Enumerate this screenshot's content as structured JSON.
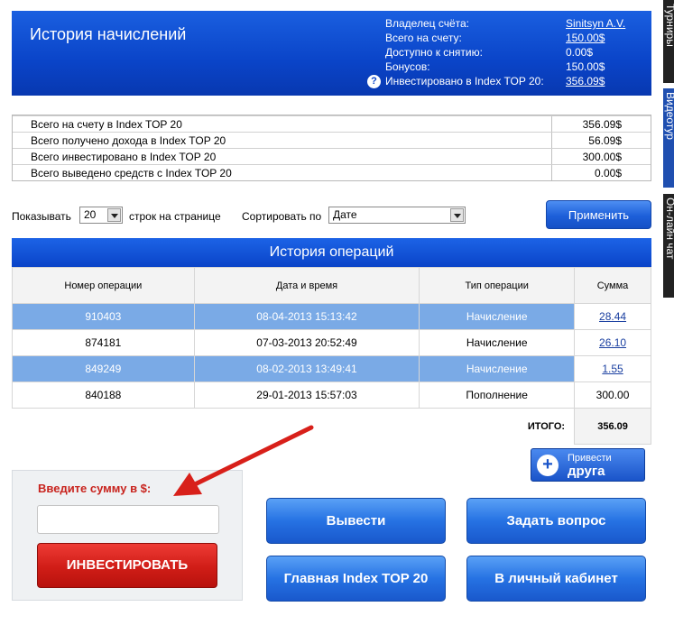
{
  "header": {
    "title": "История начислений",
    "account": [
      {
        "label": "Владелец счёта:",
        "value": "Sinitsyn A.V.",
        "link": true
      },
      {
        "label": "Всего на счету:",
        "value": "150.00$",
        "link": true
      },
      {
        "label": "Доступно к снятию:",
        "value": "0.00$",
        "link": false
      },
      {
        "label": "Бонусов:",
        "value": "150.00$",
        "link": false
      },
      {
        "label": "Инвестировано в Index TOP 20:",
        "value": "356.09$",
        "link": true
      }
    ],
    "help_glyph": "?"
  },
  "side_tabs": [
    "Турниры",
    "Видеотур",
    "Он-лайн чат"
  ],
  "summary": [
    {
      "label": "Всего на счету в Index TOP 20",
      "value": "356.09$"
    },
    {
      "label": "Всего получено дохода в Index TOP 20",
      "value": "56.09$"
    },
    {
      "label": "Всего инвестировано в Index TOP 20",
      "value": "300.00$"
    },
    {
      "label": "Всего выведено средств с Index TOP 20",
      "value": "0.00$"
    }
  ],
  "controls": {
    "show_label": "Показывать",
    "rows_value": "20",
    "rows_suffix": "строк на странице",
    "sort_label": "Сортировать по",
    "sort_value": "Дате",
    "apply_label": "Применить"
  },
  "operations": {
    "title": "История операций",
    "columns": [
      "Номер операции",
      "Дата и время",
      "Тип операции",
      "Сумма"
    ],
    "rows": [
      {
        "id": "910403",
        "datetime": "08-04-2013 15:13:42",
        "type": "Начисление",
        "amount": "28.44",
        "highlight": true,
        "link": true
      },
      {
        "id": "874181",
        "datetime": "07-03-2013 20:52:49",
        "type": "Начисление",
        "amount": "26.10",
        "highlight": false,
        "link": true
      },
      {
        "id": "849249",
        "datetime": "08-02-2013 13:49:41",
        "type": "Начисление",
        "amount": "1.55",
        "highlight": true,
        "link": true
      },
      {
        "id": "840188",
        "datetime": "29-01-2013 15:57:03",
        "type": "Пополнение",
        "amount": "300.00",
        "highlight": false,
        "link": false
      }
    ],
    "total_label": "ИТОГО:",
    "total_value": "356.09"
  },
  "invite": {
    "line1": "Привести",
    "line2": "друга"
  },
  "invest": {
    "prompt": "Введите сумму в $:",
    "amount_value": "",
    "button_label": "ИНВЕСТИРОВАТЬ"
  },
  "actions": {
    "withdraw": "Вывести",
    "ask": "Задать вопрос",
    "main": "Главная Index TOP 20",
    "cabinet": "В личный кабинет"
  },
  "colors": {
    "header_blue": "#0a44c8",
    "row_highlight": "#7aaae6",
    "invest_red": "#d01d17",
    "prompt_red": "#c8231d"
  }
}
